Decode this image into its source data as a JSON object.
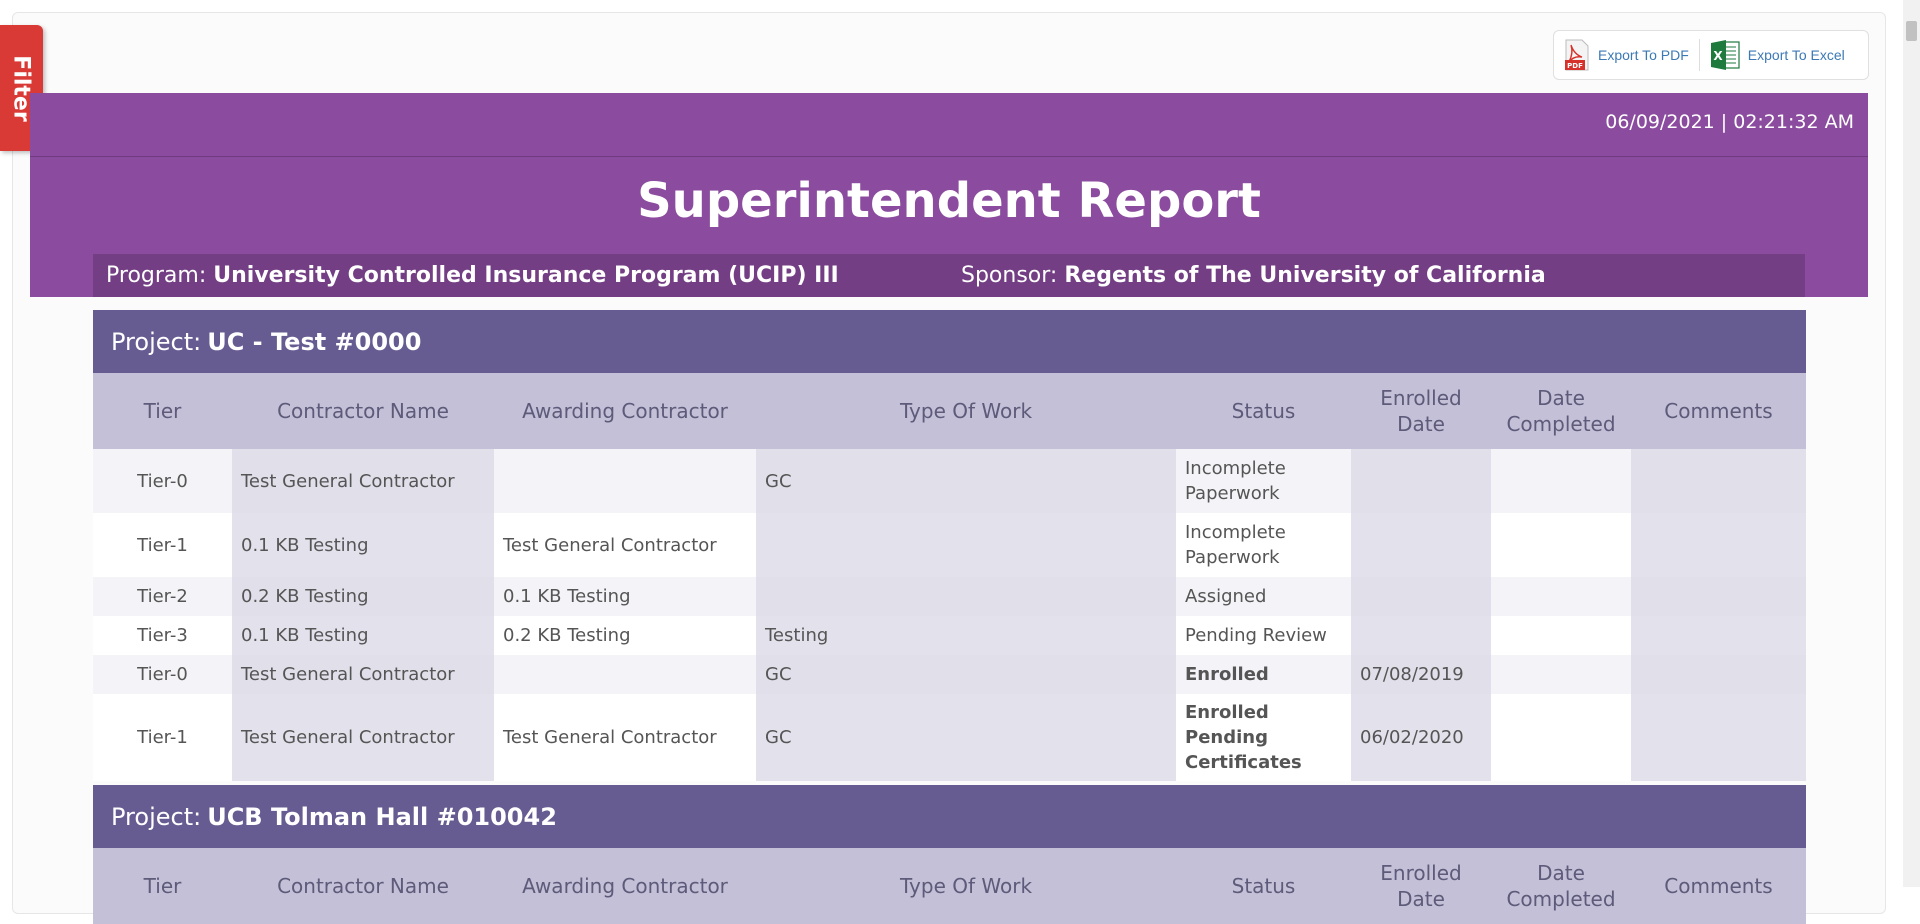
{
  "filter_tab": {
    "label": "Filter"
  },
  "export": {
    "pdf_label": "Export To PDF",
    "pdf_icon_text": "PDF",
    "excel_label": "Export To Excel",
    "excel_icon_text": "X"
  },
  "header": {
    "datetime": "06/09/2021 | 02:21:32 AM",
    "title": "Superintendent Report",
    "program_label": "Program:",
    "program_value": "University Controlled Insurance Program (UCIP) III",
    "sponsor_label": "Sponsor:",
    "sponsor_value": "Regents of The University of California"
  },
  "columns": [
    "Tier",
    "Contractor Name",
    "Awarding Contractor",
    "Type Of Work",
    "Status",
    "Enrolled Date",
    "Date Completed",
    "Comments"
  ],
  "projects": [
    {
      "label": "Project:",
      "name": "UC - Test #0000",
      "rows": [
        {
          "tier": "Tier-0",
          "contractor": "Test General Contractor",
          "awarding": "",
          "work": "GC",
          "status": "Incomplete Paperwork",
          "status_style": "red",
          "enrolled": "",
          "completed": "",
          "comments": ""
        },
        {
          "tier": "Tier-1",
          "contractor": "0.1 KB Testing",
          "awarding": "Test General Contractor",
          "work": "",
          "status": "Incomplete Paperwork",
          "status_style": "red",
          "enrolled": "",
          "completed": "",
          "comments": ""
        },
        {
          "tier": "Tier-2",
          "contractor": "0.2 KB Testing",
          "awarding": "0.1 KB Testing",
          "work": "",
          "status": "Assigned",
          "status_style": "red",
          "enrolled": "",
          "completed": "",
          "comments": ""
        },
        {
          "tier": "Tier-3",
          "contractor": "0.1 KB Testing",
          "awarding": "0.2 KB Testing",
          "work": "Testing",
          "status": "Pending Review",
          "status_style": "red",
          "enrolled": "",
          "completed": "",
          "comments": ""
        },
        {
          "tier": "Tier-0",
          "contractor": "Test General Contractor",
          "awarding": "",
          "work": "GC",
          "status": "Enrolled",
          "status_style": "bold",
          "enrolled": "07/08/2019",
          "completed": "",
          "comments": ""
        },
        {
          "tier": "Tier-1",
          "contractor": "Test General Contractor",
          "awarding": "Test General Contractor",
          "work": "GC",
          "status": "Enrolled Pending Certificates",
          "status_style": "bold",
          "enrolled": "06/02/2020",
          "completed": "",
          "comments": ""
        }
      ]
    },
    {
      "label": "Project:",
      "name": "UCB Tolman Hall #010042",
      "rows": []
    }
  ],
  "colors": {
    "header_purple": "#8b4b9e",
    "project_bar": "#675c92",
    "column_header": "#c3c0d7",
    "status_red": "#e0212b",
    "filter_red": "#d93a36"
  }
}
